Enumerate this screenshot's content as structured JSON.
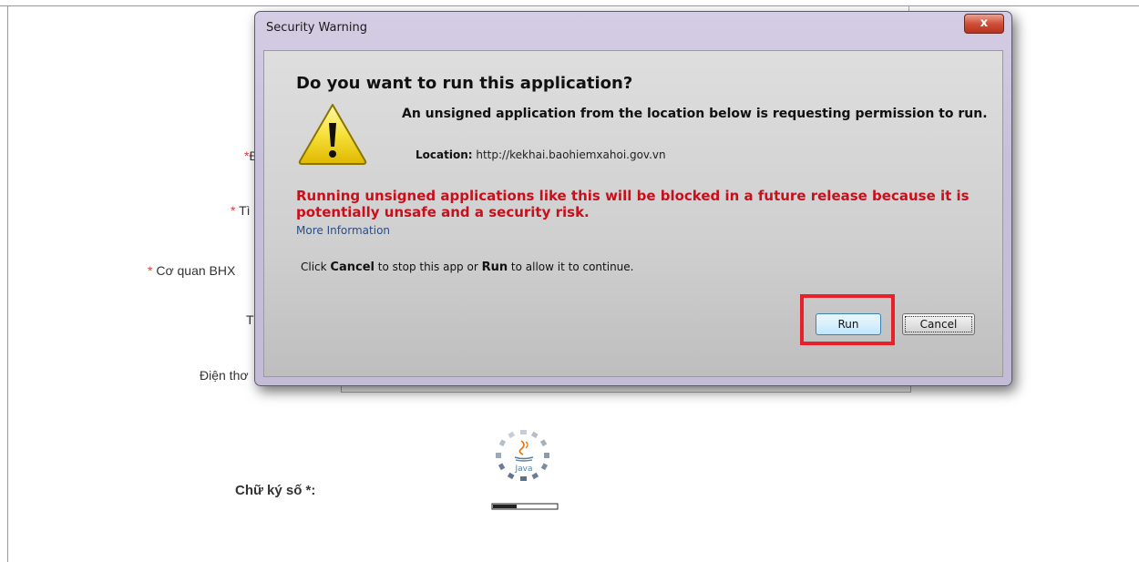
{
  "form": {
    "labels": [
      {
        "req": "*",
        "text": "Đ"
      },
      {
        "req": "* ",
        "text": "Tì"
      },
      {
        "req": "* ",
        "text": "Cơ quan BHX"
      },
      {
        "req": "",
        "text": "Tế"
      },
      {
        "req": "",
        "text": "Điện thơ"
      }
    ],
    "signature_label": "Chữ ký số *:",
    "java_loader_text": "Java"
  },
  "dialog": {
    "title": "Security Warning",
    "close_label": "x",
    "heading": "Do you want to run this application?",
    "description": "An unsigned application from the location below is requesting permission to run.",
    "location_label": "Location:",
    "location_value": "http://kekhai.baohiemxahoi.gov.vn",
    "red_warning": "Running unsigned applications like this will be blocked in a future release because it is potentially unsafe and a security risk.",
    "more_info": "More Information",
    "instructions": {
      "part1": "Click ",
      "cancel_word": "Cancel",
      "part2": " to stop this app or ",
      "run_word": "Run",
      "part3": " to allow it to continue."
    },
    "run_button": "Run",
    "cancel_button": "Cancel"
  },
  "colors": {
    "warning_red": "#c8101c",
    "highlight_red": "#e8202a",
    "link_blue": "#2b4d86"
  },
  "icons": [
    "warning-triangle-icon",
    "close-icon",
    "java-icon"
  ]
}
